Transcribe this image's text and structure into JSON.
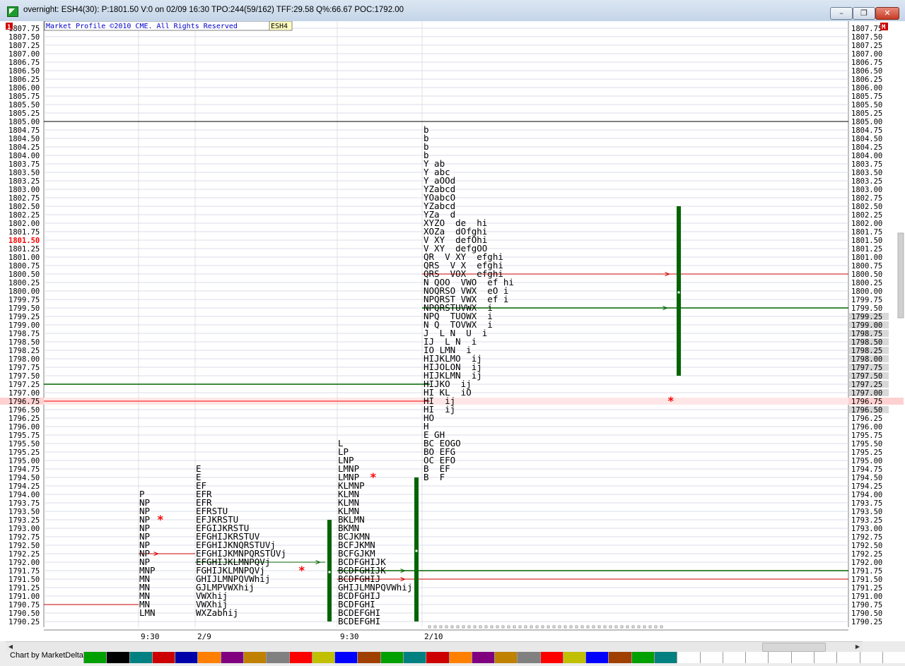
{
  "window": {
    "title": "overnight: ESH4(30): P:1801.50 V:0 on 02/09 16:30 TPO:244(59/162) TFF:29.58 Q%:66.67 POC:1792.00",
    "minimize_label": "–",
    "restore_label": "❐",
    "close_label": "✕"
  },
  "chart": {
    "copyright": "Market Profile ©2010 CME. All Rights Reserved",
    "symbol_tag": "ESH4",
    "left_corner_badge": "1",
    "right_corner_badge": "M",
    "current_price_label": "1801.50",
    "highlight_price_label": "1796.75"
  },
  "colors": {
    "grid": "#d8dde8",
    "current_price": "#ff0000",
    "value_area_bar": "#006400",
    "poc_line": "#006400",
    "value_area_high_line": "#cc0000",
    "open_circle_blue": "#0000cc"
  },
  "chart_data": {
    "type": "market_profile",
    "y_min": 1790.25,
    "y_max": 1807.75,
    "tick": 0.25,
    "price_labels": [
      "1807.75",
      "1807.50",
      "1807.25",
      "1807.00",
      "1806.75",
      "1806.50",
      "1806.25",
      "1806.00",
      "1805.75",
      "1805.50",
      "1805.25",
      "1805.00",
      "1804.75",
      "1804.50",
      "1804.25",
      "1804.00",
      "1803.75",
      "1803.50",
      "1803.25",
      "1803.00",
      "1802.75",
      "1802.50",
      "1802.25",
      "1802.00",
      "1801.75",
      "1801.50",
      "1801.25",
      "1801.00",
      "1800.75",
      "1800.50",
      "1800.25",
      "1800.00",
      "1799.75",
      "1799.50",
      "1799.25",
      "1799.00",
      "1798.75",
      "1798.50",
      "1798.25",
      "1798.00",
      "1797.75",
      "1797.50",
      "1797.25",
      "1797.00",
      "1796.75",
      "1796.50",
      "1796.25",
      "1796.00",
      "1795.75",
      "1795.50",
      "1795.25",
      "1795.00",
      "1794.75",
      "1794.50",
      "1794.25",
      "1794.00",
      "1793.75",
      "1793.50",
      "1793.25",
      "1793.00",
      "1792.75",
      "1792.50",
      "1792.25",
      "1792.00",
      "1791.75",
      "1791.50",
      "1791.25",
      "1791.00",
      "1790.75",
      "1790.50",
      "1790.25"
    ],
    "x_axis_labels": [
      "9:30",
      "2/9",
      "9:30",
      "2/10"
    ],
    "profiles": [
      {
        "name": "first",
        "top_price": 1794.0,
        "rows": [
          "P",
          "NP",
          "NP",
          "NP",
          "NP",
          "NP",
          "NP",
          "NP",
          "NP",
          "MNP",
          "MN",
          "MN",
          "MN",
          "MN",
          "LMN"
        ]
      },
      {
        "name": "second",
        "top_price": 1794.75,
        "rows": [
          "E",
          "E",
          "EF",
          "EFR",
          "EFR",
          "EFRSTU",
          "EFJKRSTU",
          "EFGIJKRSTU",
          "EFGHIJKRSTUV",
          "EFGHIJKNQRSTUVj",
          "EFGHIJKMNPQRSTUVj",
          "EFGHIJKLMNPQVj",
          "FGHIJKLMNPQVj",
          "GHIJLMNPQVWhij",
          "GJLMPVWXhij",
          "VWXhij",
          "VWXhij",
          "WXZabhij"
        ]
      },
      {
        "name": "third",
        "top_price": 1795.5,
        "rows": [
          "L",
          "LP",
          "LNP",
          "LMNP",
          "LMNP",
          "KLMNP",
          "KLMN",
          "KLMN",
          "KLMN",
          "BKLMN",
          "BKMN",
          "BCJKMN",
          "BCFJKMN",
          "BCFGJKM",
          "BCDFGHIJK",
          "BCDFGHIJK",
          "BCDFGHIJ",
          "GHIJLMNPQVWhij",
          "BCDFGHIJ",
          "BCDFGHI",
          "BCDEFGHI",
          "BCDEFGHI"
        ]
      },
      {
        "name": "fourth",
        "top_price": 1804.75,
        "rows": [
          "b",
          "b",
          "b",
          "b",
          "Y ab",
          "Y abc",
          "Y aOOd",
          "YZabcd",
          "YOabcO",
          "YZabcd",
          "YZa  d",
          "XYZO  de  hi",
          "XOZa  dOfghi",
          "V XY  defOhi",
          "V XY  defgOO",
          "QR  V XY  efghi",
          "QRS  V X  efghi",
          "QRS  VOX  efghi",
          "N QOO  VWO  ef hi",
          "NOQRSO VWX  eO i",
          "NPQRST VWX  ef i",
          "NPQRSTUVWX  i",
          "NPQ  TUOWX  i",
          "N Q  TOVWX  i",
          "J  L N  U  i",
          "IJ  L N  i",
          "IO LMN  i",
          "HIJKLMO  ij",
          "HIJOLON  ij",
          "HIJKLMN  ij",
          "HIJKO  ij",
          "HI KL  iO",
          "HI  ij",
          "HI  ij",
          "HO",
          "H",
          "E GH",
          "BC EOGO",
          "BO EFG",
          "OC EFO",
          "B  EF",
          "B  F"
        ]
      }
    ],
    "value_area_lines": [
      {
        "price": 1797.25,
        "color": "#006400"
      },
      {
        "price": 1796.75,
        "color": "#ff0000"
      },
      {
        "price": 1800.5,
        "color": "#cc0000"
      },
      {
        "price": 1799.5,
        "color": "#006400"
      },
      {
        "price": 1791.75,
        "color": "#006400"
      },
      {
        "price": 1791.5,
        "color": "#cc0000"
      },
      {
        "price": 1805.0,
        "color": "#000000"
      }
    ]
  },
  "footer": {
    "credit": "Chart by MarketDelta",
    "palette": [
      "#00a000",
      "#000000",
      "#008080",
      "#cc0000",
      "#0000aa",
      "#ff8000",
      "#800080",
      "#c08000",
      "#808080",
      "#ff0000",
      "#c0c000",
      "#0000ff",
      "#a04000",
      "#00a000",
      "#008080",
      "#cc0000",
      "#ff8000",
      "#800080",
      "#c08000",
      "#808080",
      "#ff0000",
      "#c0c000",
      "#0000ff",
      "#a04000",
      "#00a000",
      "#008080",
      "#ffffff",
      "#ffffff",
      "#ffffff",
      "#ffffff",
      "#ffffff",
      "#ffffff",
      "#ffffff",
      "#ffffff",
      "#ffffff",
      "#ffffff"
    ]
  }
}
